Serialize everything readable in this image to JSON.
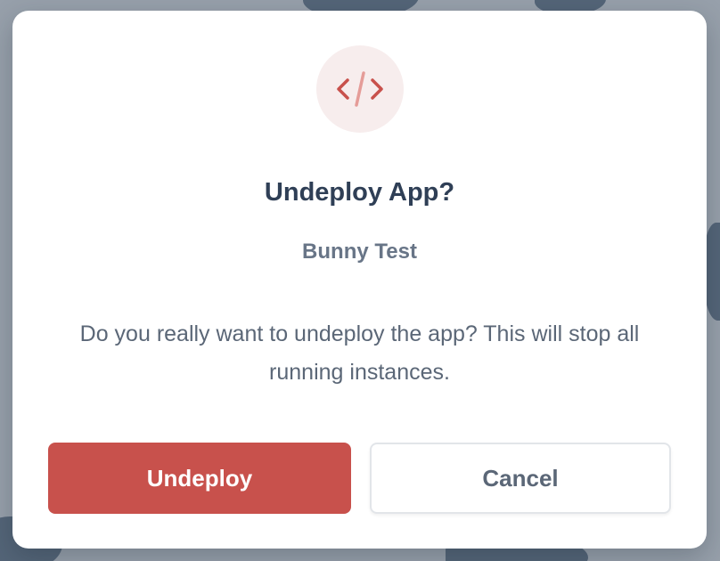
{
  "dialog": {
    "icon": "code-icon",
    "title": "Undeploy App?",
    "app_name": "Bunny Test",
    "message": "Do you really want to undeploy the app? This will stop all running instances.",
    "confirm_label": "Undeploy",
    "cancel_label": "Cancel"
  },
  "colors": {
    "accent": "#c8514c",
    "icon_background": "#f7eded",
    "title_text": "#2f3f56",
    "secondary_text": "#687587",
    "overlay": "#97a0ab"
  }
}
